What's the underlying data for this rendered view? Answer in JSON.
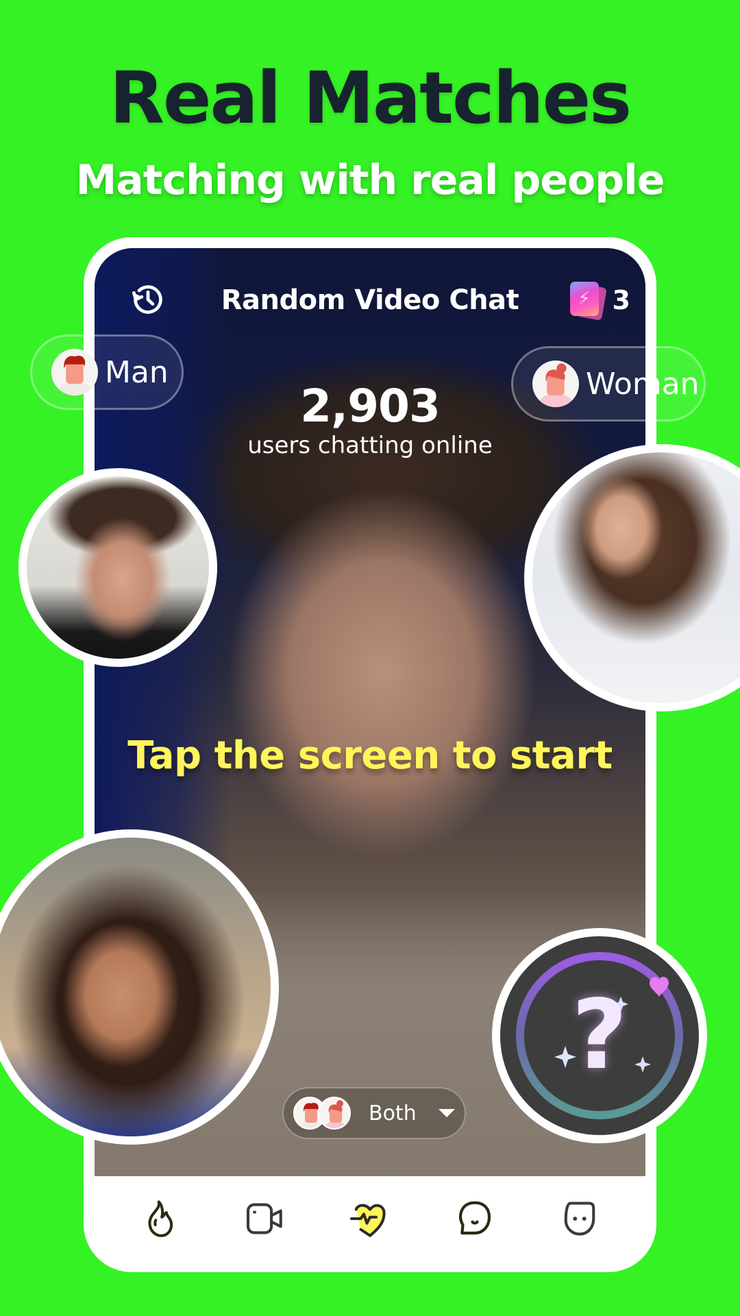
{
  "promo": {
    "headline": "Real Matches",
    "subheadline": "Matching with real people"
  },
  "header": {
    "history_icon": "history-icon",
    "title": "Random Video Chat",
    "tickets_icon": "lightning-ticket-icon",
    "tickets_count": "3"
  },
  "gender_filter": {
    "man_label": "Man",
    "woman_label": "Woman"
  },
  "online": {
    "count": "2,903",
    "label": "users chatting online"
  },
  "main": {
    "tap_hint": "Tap the screen to start",
    "match_filter": {
      "selected": "Both"
    },
    "mystery_match_icon": "question-mark-icon"
  },
  "profiles": [
    {
      "name": "profile-photo-man"
    },
    {
      "name": "profile-photo-woman-right"
    },
    {
      "name": "profile-photo-woman-left"
    }
  ],
  "nav": {
    "items": [
      {
        "icon": "flame-icon",
        "active": false
      },
      {
        "icon": "video-camera-icon",
        "active": false
      },
      {
        "icon": "heartbeat-icon",
        "active": true
      },
      {
        "icon": "chat-bubble-icon",
        "active": false
      },
      {
        "icon": "face-icon",
        "active": false
      }
    ]
  },
  "colors": {
    "background": "#35f225",
    "headline": "#17232e",
    "tap_hint": "#fff55a",
    "active_nav_fill": "#fff55a",
    "icon_stroke": "#2b2b22"
  }
}
